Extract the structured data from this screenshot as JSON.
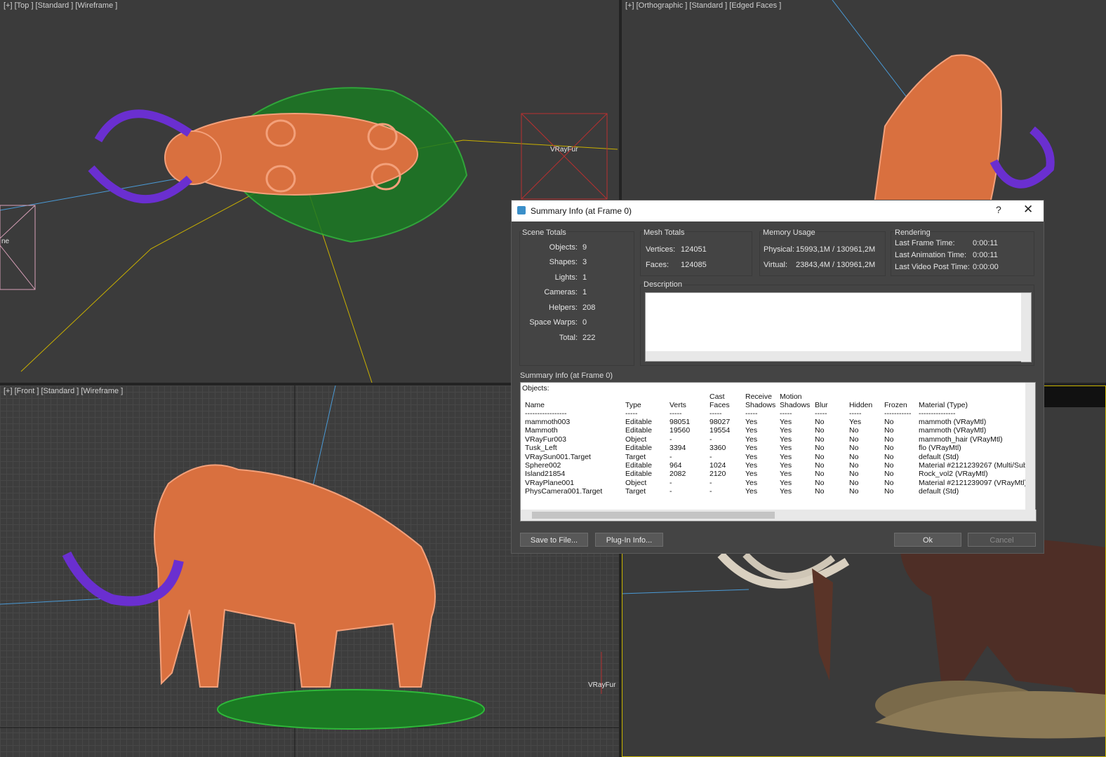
{
  "viewports": {
    "top": {
      "label": "[+] [Top ] [Standard ] [Wireframe ]",
      "obj_label": "VRayFur",
      "side_label": "ne"
    },
    "ortho": {
      "label": "[+] [Orthographic ] [Standard ] [Edged Faces ]"
    },
    "front": {
      "label": "[+] [Front ] [Standard ] [Wireframe ]",
      "obj_label": "VRayFur"
    }
  },
  "dialog": {
    "title": "Summary Info (at Frame 0)",
    "help": "?",
    "close": "✕",
    "scene_totals": {
      "title": "Scene Totals",
      "rows": [
        {
          "label": "Objects:",
          "value": "9"
        },
        {
          "label": "Shapes:",
          "value": "3"
        },
        {
          "label": "Lights:",
          "value": "1"
        },
        {
          "label": "Cameras:",
          "value": "1"
        },
        {
          "label": "Helpers:",
          "value": "208"
        },
        {
          "label": "Space Warps:",
          "value": "0"
        },
        {
          "label": "Total:",
          "value": "222"
        }
      ]
    },
    "mesh_totals": {
      "title": "Mesh Totals",
      "vertices_label": "Vertices:",
      "vertices": "124051",
      "faces_label": "Faces:",
      "faces": "124085"
    },
    "memory": {
      "title": "Memory Usage",
      "physical_label": "Physical:",
      "physical": "15993,1M / 130961,2M",
      "virtual_label": "Virtual:",
      "virtual": "23843,4M / 130961,2M"
    },
    "rendering": {
      "title": "Rendering",
      "last_frame_label": "Last Frame Time:",
      "last_frame": "0:00:11",
      "last_anim_label": "Last Animation Time:",
      "last_anim": "0:00:11",
      "last_video_label": "Last Video Post Time:",
      "last_video": "0:00:00"
    },
    "description": {
      "title": "Description",
      "value": ""
    },
    "summary": {
      "label": "Summary Info (at Frame 0)",
      "objects_heading": "Objects:",
      "headers_top": [
        "",
        "",
        "",
        "Cast",
        "Receive",
        "Motion",
        "",
        "",
        "",
        ""
      ],
      "headers": [
        "Name",
        "Type",
        "Verts",
        "Faces",
        "Shadows",
        "Shadows",
        "Blur",
        "Hidden",
        "Frozen",
        "Material (Type)"
      ],
      "separators": [
        "-----------------",
        "-----",
        "-----",
        "-----",
        "-----",
        "-----",
        "-----",
        "-----",
        "-----------",
        "---------------"
      ],
      "rows": [
        [
          "mammoth003",
          "Editable",
          "98051",
          "98027",
          "Yes",
          "Yes",
          "No",
          "Yes",
          "No",
          "mammoth (VRayMtl)"
        ],
        [
          "Mammoth",
          "Editable",
          "19560",
          "19554",
          "Yes",
          "Yes",
          "No",
          "No",
          "No",
          "mammoth (VRayMtl)"
        ],
        [
          "VRayFur003",
          "Object",
          "-",
          "-",
          "Yes",
          "Yes",
          "No",
          "No",
          "No",
          "mammoth_hair (VRayMtl)"
        ],
        [
          "Tusk_Left",
          "Editable",
          "3394",
          "3360",
          "Yes",
          "Yes",
          "No",
          "No",
          "No",
          "flo (VRayMtl)"
        ],
        [
          "VRaySun001.Target",
          "Target",
          "-",
          "-",
          "Yes",
          "Yes",
          "No",
          "No",
          "No",
          "default (Std)"
        ],
        [
          "Sphere002",
          "Editable",
          "964",
          "1024",
          "Yes",
          "Yes",
          "No",
          "No",
          "No",
          "Material #2121239267 (Multi/Sub"
        ],
        [
          "Island21854",
          "Editable",
          "2082",
          "2120",
          "Yes",
          "Yes",
          "No",
          "No",
          "No",
          "Rock_vol2 (VRayMtl)"
        ],
        [
          "VRayPlane001",
          "Object",
          "-",
          "-",
          "Yes",
          "Yes",
          "No",
          "No",
          "No",
          "Material #2121239097 (VRayMtl)"
        ],
        [
          "PhysCamera001.Target",
          "Target",
          "-",
          "-",
          "Yes",
          "Yes",
          "No",
          "No",
          "No",
          "default (Std)"
        ]
      ]
    },
    "buttons": {
      "save": "Save to File...",
      "plugin": "Plug-In Info...",
      "ok": "Ok",
      "cancel": "Cancel"
    }
  },
  "colors": {
    "wire_orange": "#f08a5a",
    "wire_green": "#1f9a2a",
    "tusk_purple": "#6a2fd0",
    "dialog_bg": "#444444"
  }
}
